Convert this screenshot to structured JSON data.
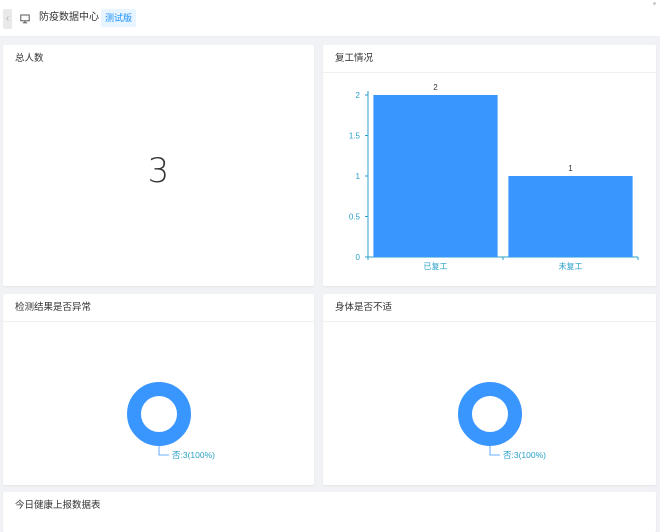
{
  "header": {
    "back_glyph": "‹",
    "title": "防疫数据中心",
    "badge": "测试版"
  },
  "cards": {
    "total": {
      "title": "总人数",
      "value": "3"
    },
    "resumed": {
      "title": "复工情况"
    },
    "abnormal": {
      "title": "检测结果是否异常",
      "label": "否:3(100%)"
    },
    "unwell": {
      "title": "身体是否不适",
      "label": "否:3(100%)"
    },
    "report_table": {
      "title": "今日健康上报数据表"
    }
  },
  "colors": {
    "accent": "#3a96ff",
    "axis": "#29a1c8",
    "badge_bg": "#e8f4ff",
    "badge_text": "#1890ff"
  },
  "chart_data": [
    {
      "type": "bar",
      "categories": [
        "已复工",
        "未复工"
      ],
      "values": [
        2,
        1
      ],
      "ylim": [
        0,
        2
      ],
      "yticks": [
        "0",
        "0.5",
        "1",
        "1.5",
        "2"
      ],
      "data_labels": [
        "2",
        "1"
      ],
      "grid": false
    },
    {
      "type": "pie",
      "variant": "donut",
      "slices": [
        {
          "label": "否",
          "value": 3,
          "percent": 100
        }
      ]
    },
    {
      "type": "pie",
      "variant": "donut",
      "slices": [
        {
          "label": "否",
          "value": 3,
          "percent": 100
        }
      ]
    }
  ]
}
